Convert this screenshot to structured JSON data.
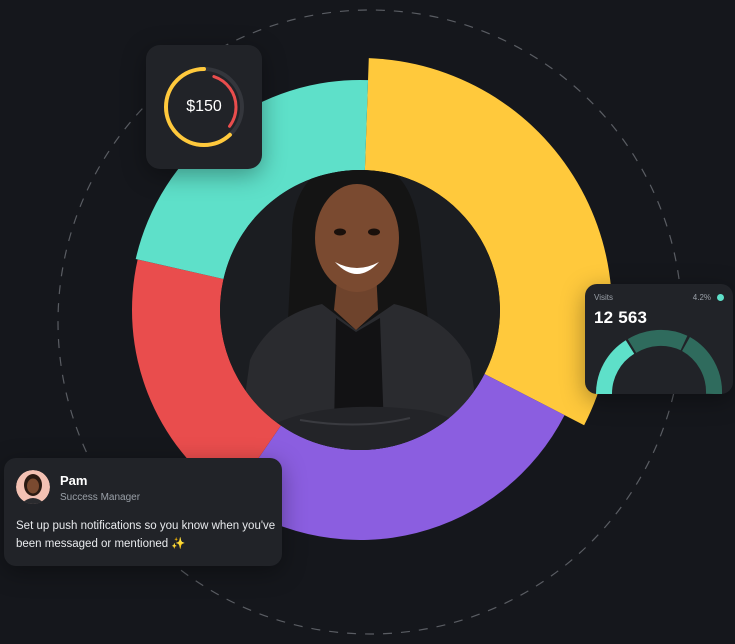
{
  "colors": {
    "background": "#15171c",
    "card": "#212328",
    "yellow": "#ffc93c",
    "purple": "#8b5ee0",
    "red": "#e94d4d",
    "teal": "#5ee0c9",
    "gauge_dark": "#2f6b5d"
  },
  "donut_segments": [
    {
      "name": "yellow",
      "color": "#ffc93c",
      "share": 0.32
    },
    {
      "name": "purple",
      "color": "#8b5ee0",
      "share": 0.27
    },
    {
      "name": "red",
      "color": "#e94d4d",
      "share": 0.19
    },
    {
      "name": "teal",
      "color": "#5ee0c9",
      "share": 0.22
    }
  ],
  "price_card": {
    "value": "$150",
    "ring_progress": 0.55
  },
  "visits_card": {
    "label": "Visits",
    "change": "4.2%",
    "value": "12 563"
  },
  "chat_card": {
    "name": "Pam",
    "role": "Success Manager",
    "message": "Set up push notifications so you know when you've been messaged or mentioned ✨"
  },
  "photo": {
    "icon": "person-portrait"
  }
}
